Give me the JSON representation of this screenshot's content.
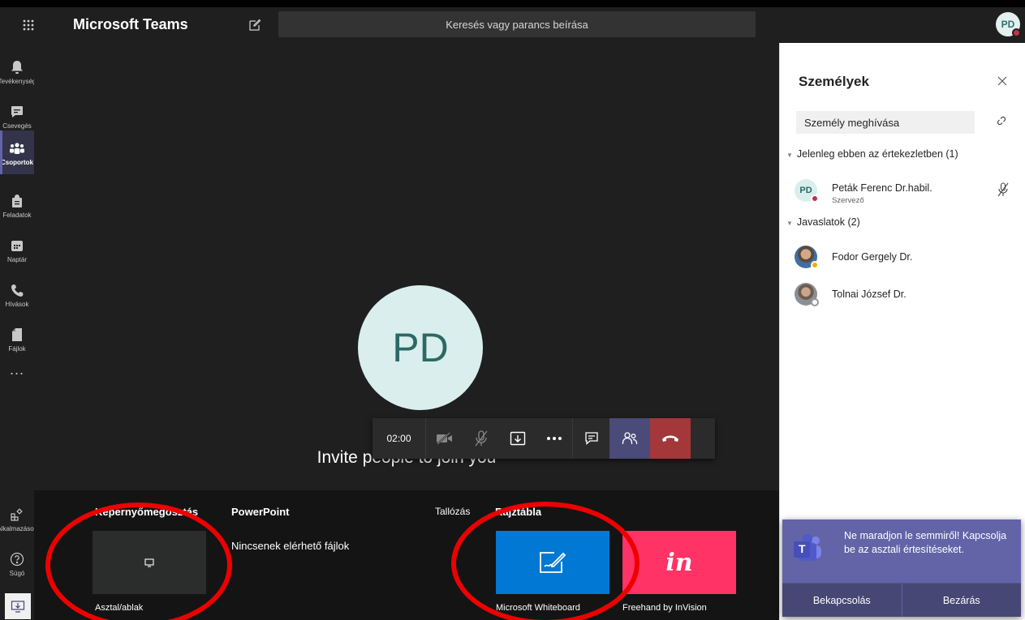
{
  "app": {
    "title": "Microsoft Teams"
  },
  "search": {
    "placeholder": "Keresés vagy parancs beírása"
  },
  "user": {
    "initials": "PD",
    "status_color": "#c4314b"
  },
  "rail": {
    "items": [
      {
        "label": "Tevékenység",
        "icon": "bell-icon"
      },
      {
        "label": "Csevegés",
        "icon": "chat-icon"
      },
      {
        "label": "Csoportok",
        "icon": "teams-icon",
        "active": true
      },
      {
        "label": "Feladatok",
        "icon": "assignments-icon"
      },
      {
        "label": "Naptár",
        "icon": "calendar-icon"
      },
      {
        "label": "Hívások",
        "icon": "phone-icon"
      },
      {
        "label": "Fájlok",
        "icon": "file-icon"
      }
    ],
    "more": "...",
    "apps_label": "Alkalmazások",
    "help_label": "Súgó"
  },
  "stage": {
    "avatar_initials": "PD",
    "invite_text": "Invite people to join you"
  },
  "callbar": {
    "timer": "02:00",
    "accent": "#4a4b78",
    "hangup_color": "#a4373a"
  },
  "tray": {
    "screen_share_heading": "Képernyőmegosztás",
    "powerpoint_heading": "PowerPoint",
    "browse_label": "Tallózás",
    "whiteboard_heading": "Rajztábla",
    "no_files": "Nincsenek elérhető fájlok",
    "desktop_label": "Asztal/ablak",
    "ms_whiteboard_label": "Microsoft Whiteboard",
    "invision_label": "Freehand by InVision",
    "invision_logo_text": "in",
    "ms_whiteboard_color": "#0078d4",
    "invision_color": "#ff3366"
  },
  "panel": {
    "title": "Személyek",
    "invite_placeholder": "Személy meghívása",
    "in_meeting_heading": "Jelenleg ebben az értekezletben (1)",
    "suggestions_heading": "Javaslatok (2)",
    "participants": [
      {
        "initials": "PD",
        "name": "Peták Ferenc Dr.habil.",
        "role": "Szervező",
        "status_color": "#c4314b"
      }
    ],
    "suggestions": [
      {
        "name": "Fodor Gergely Dr.",
        "status_color": "#f8a800"
      },
      {
        "name": "Tolnai József Dr.",
        "status_color": "#ffffff"
      }
    ]
  },
  "toast": {
    "message": "Ne maradjon le semmiről! Kapcsolja be az asztali értesítéseket.",
    "enable_label": "Bekapcsolás",
    "close_label": "Bezárás",
    "logo_letter": "T"
  },
  "annotation_color": "#ee0000"
}
